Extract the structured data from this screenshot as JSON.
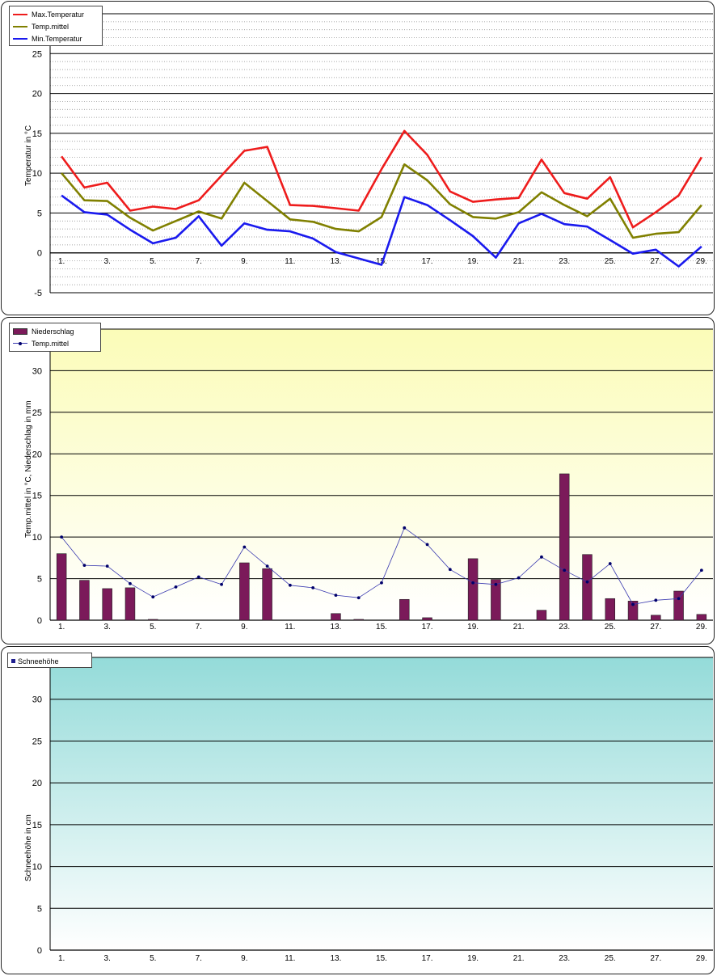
{
  "chart_data": [
    {
      "type": "line",
      "title": "",
      "ylabel": "Temperatur in °C",
      "xlabel": "",
      "ylim": [
        -5,
        30
      ],
      "yticks": [
        -5,
        0,
        5,
        10,
        15,
        20,
        25
      ],
      "grid": true,
      "legend_position": "top-left",
      "x": [
        1,
        2,
        3,
        4,
        5,
        6,
        7,
        8,
        9,
        10,
        11,
        12,
        13,
        14,
        15,
        16,
        17,
        18,
        19,
        20,
        21,
        22,
        23,
        24,
        25,
        26,
        27,
        28,
        29
      ],
      "x_tick_labels": [
        "1.",
        "3.",
        "5.",
        "7.",
        "9.",
        "11.",
        "13.",
        "15.",
        "17.",
        "19.",
        "21.",
        "23.",
        "25.",
        "27.",
        "29."
      ],
      "series": [
        {
          "name": "Max.Temperatur",
          "color": "#ee1c1c",
          "values": [
            12.1,
            8.2,
            8.8,
            5.3,
            5.8,
            5.5,
            6.6,
            9.7,
            12.8,
            13.3,
            6.0,
            5.9,
            5.6,
            5.3,
            10.5,
            15.3,
            12.3,
            7.7,
            6.4,
            6.7,
            6.9,
            11.7,
            7.5,
            6.8,
            9.5,
            3.2,
            5.1,
            7.2,
            12.0
          ]
        },
        {
          "name": "Temp.mittel",
          "color": "#808000",
          "values": [
            10.0,
            6.6,
            6.5,
            4.4,
            2.8,
            4.0,
            5.2,
            4.3,
            8.8,
            6.5,
            4.2,
            3.9,
            3.0,
            2.7,
            4.5,
            11.1,
            9.1,
            6.1,
            4.5,
            4.3,
            5.1,
            7.6,
            6.0,
            4.6,
            6.8,
            1.9,
            2.4,
            2.6,
            6.0
          ]
        },
        {
          "name": "Min.Temperatur",
          "color": "#1a1aee",
          "values": [
            7.2,
            5.1,
            4.8,
            2.9,
            1.2,
            1.9,
            4.6,
            0.9,
            3.7,
            2.9,
            2.7,
            1.8,
            0.1,
            -0.7,
            -1.5,
            7.0,
            6.0,
            4.1,
            2.1,
            -0.6,
            3.7,
            4.9,
            3.6,
            3.3,
            1.6,
            -0.1,
            0.4,
            -1.7,
            0.8
          ]
        }
      ]
    },
    {
      "type": "bar",
      "title": "",
      "ylabel": "Temp.mittel in °C, Niederschlag in mm",
      "xlabel": "",
      "ylim": [
        0,
        35
      ],
      "yticks": [
        0,
        5,
        10,
        15,
        20,
        25,
        30
      ],
      "grid": true,
      "legend_position": "top-left",
      "x": [
        1,
        2,
        3,
        4,
        5,
        6,
        7,
        8,
        9,
        10,
        11,
        12,
        13,
        14,
        15,
        16,
        17,
        18,
        19,
        20,
        21,
        22,
        23,
        24,
        25,
        26,
        27,
        28,
        29
      ],
      "x_tick_labels": [
        "1.",
        "3.",
        "5.",
        "7.",
        "9.",
        "11.",
        "13.",
        "15.",
        "17.",
        "19.",
        "21.",
        "23.",
        "25.",
        "27.",
        "29."
      ],
      "series": [
        {
          "name": "Niederschlag",
          "kind": "bar",
          "color": "#7b1a5a",
          "values": [
            8.0,
            4.8,
            3.8,
            3.9,
            0.1,
            0,
            0,
            0,
            6.9,
            6.2,
            0,
            0,
            0.8,
            0.1,
            0,
            2.5,
            0.3,
            0,
            7.4,
            4.9,
            0,
            1.2,
            17.6,
            7.9,
            2.6,
            2.3,
            0.6,
            3.5,
            0.7
          ]
        },
        {
          "name": "Temp.mittel",
          "kind": "line",
          "color": "#3a3ab0",
          "values": [
            10.0,
            6.6,
            6.5,
            4.4,
            2.8,
            4.0,
            5.2,
            4.3,
            8.8,
            6.5,
            4.2,
            3.9,
            3.0,
            2.7,
            4.5,
            11.1,
            9.1,
            6.1,
            4.5,
            4.3,
            5.1,
            7.6,
            6.0,
            4.6,
            6.8,
            1.9,
            2.4,
            2.6,
            6.0
          ]
        }
      ],
      "background_gradient": [
        "#fbfcb8",
        "#ffffff"
      ]
    },
    {
      "type": "bar",
      "title": "",
      "ylabel": "Schneehöhe in cm",
      "xlabel": "",
      "ylim": [
        0,
        35
      ],
      "yticks": [
        0,
        5,
        10,
        15,
        20,
        25,
        30
      ],
      "grid": true,
      "legend_position": "top-left",
      "x": [
        1,
        2,
        3,
        4,
        5,
        6,
        7,
        8,
        9,
        10,
        11,
        12,
        13,
        14,
        15,
        16,
        17,
        18,
        19,
        20,
        21,
        22,
        23,
        24,
        25,
        26,
        27,
        28,
        29
      ],
      "x_tick_labels": [
        "1.",
        "3.",
        "5.",
        "7.",
        "9.",
        "11.",
        "13.",
        "15.",
        "17.",
        "19.",
        "21.",
        "23.",
        "25.",
        "27.",
        "29."
      ],
      "series": [
        {
          "name": "Schneehöhe",
          "kind": "bar",
          "color": "#1f1f8f",
          "values": [
            0,
            0,
            0,
            0,
            0,
            0,
            0,
            0,
            0,
            0,
            0,
            0,
            0,
            0,
            0,
            0,
            0,
            0,
            0,
            0,
            0,
            0,
            0,
            0,
            0,
            0,
            0,
            0,
            0
          ]
        }
      ],
      "background_gradient": [
        "#94dbd9",
        "#ffffff"
      ]
    }
  ]
}
